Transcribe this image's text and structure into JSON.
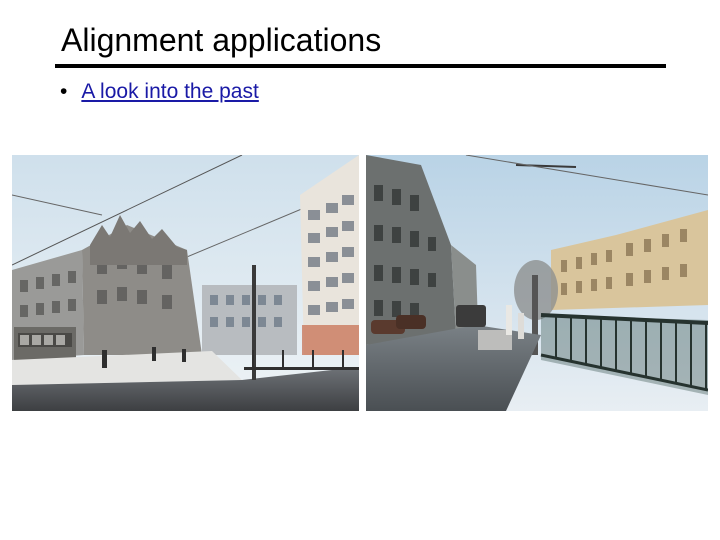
{
  "slide": {
    "title": "Alignment applications",
    "bullets": [
      {
        "marker": "•",
        "text": "A look into the past"
      }
    ]
  },
  "photos": [
    {
      "name": "now-and-then-street-corner",
      "content": "present-day street corner blended with wartime ruined building and tram"
    },
    {
      "name": "now-and-then-canal-street",
      "content": "present-day canal embankment street blended with historical figures by the railing"
    }
  ],
  "colors": {
    "link": "#1a1aa6",
    "text": "#000000",
    "rule": "#000000"
  }
}
